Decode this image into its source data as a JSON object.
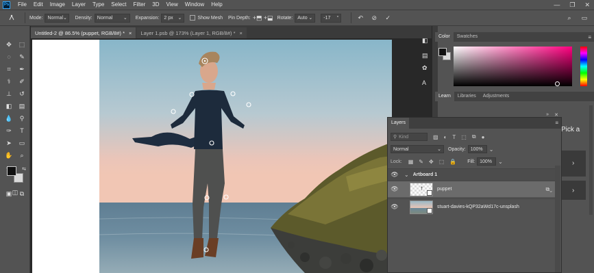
{
  "menubar": {
    "logo": "Ps",
    "items": [
      "File",
      "Edit",
      "Image",
      "Layer",
      "Type",
      "Select",
      "Filter",
      "3D",
      "View",
      "Window",
      "Help"
    ]
  },
  "options": {
    "mode_label": "Mode:",
    "mode_value": "Normal",
    "density_label": "Density:",
    "density_value": "Normal",
    "expansion_label": "Expansion:",
    "expansion_value": "2 px",
    "show_mesh_label": "Show Mesh",
    "pin_depth_label": "Pin Depth:",
    "rotate_label": "Rotate:",
    "rotate_mode": "Auto",
    "rotate_value": "-17"
  },
  "tabs": [
    {
      "label": "Untitled-2 @ 86.5% (puppet, RGB/8#) *",
      "close": "×"
    },
    {
      "label": "Layer 1.psb @ 173% (Layer 1, RGB/8#) *",
      "close": "×"
    }
  ],
  "color_panel": {
    "tabs": [
      "Color",
      "Swatches"
    ],
    "colors": {
      "foreground": "#111111",
      "background": "#d9d9d9"
    }
  },
  "learn_panel": {
    "tabs": [
      "Learn",
      "Libraries",
      "Adjustments"
    ],
    "partial_text": "Pick a"
  },
  "layers_panel": {
    "title": "Layers",
    "kind_label": "Kind",
    "blend_mode": "Normal",
    "opacity_label": "Opacity:",
    "opacity_value": "100%",
    "lock_label": "Lock:",
    "fill_label": "Fill:",
    "fill_value": "100%",
    "group_name": "Artboard 1",
    "layers": [
      {
        "name": "puppet"
      },
      {
        "name": "stuart-davies-kQP32aWd17c-unsplash"
      }
    ]
  },
  "colors": {
    "accent": "#31a8ff",
    "panel": "#535353",
    "dark": "#282828"
  }
}
